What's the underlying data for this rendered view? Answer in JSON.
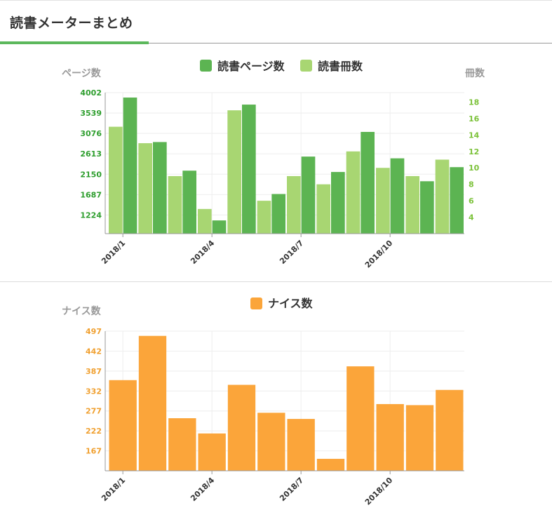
{
  "header": {
    "title": "読書メーターまとめ"
  },
  "colors": {
    "pages": "#5cb452",
    "books": "#a8d672",
    "nice": "#fba53a",
    "left_axis_text": "#2e9e2e",
    "right_axis_text": "#7cc23a",
    "nice_axis_text": "#f0a030"
  },
  "chart_data": [
    {
      "type": "bar",
      "categories": [
        "2018/1",
        "2018/2",
        "2018/3",
        "2018/4",
        "2018/5",
        "2018/6",
        "2018/7",
        "2018/8",
        "2018/9",
        "2018/10",
        "2018/11",
        "2018/12"
      ],
      "xtick_labels": [
        "2018/1",
        "2018/4",
        "2018/7",
        "2018/10"
      ],
      "legend": [
        "読書ページ数",
        "読書冊数"
      ],
      "left_unit": "ページ数",
      "right_unit": "冊数",
      "left_ticks": [
        1224,
        1687,
        2150,
        2613,
        3076,
        3539,
        4002
      ],
      "right_ticks": [
        4,
        6,
        8,
        10,
        12,
        14,
        16,
        18
      ],
      "left_ylim": [
        800,
        4002
      ],
      "right_ylim": [
        2,
        19.15
      ],
      "grid": true,
      "series": [
        {
          "name": "読書ページ数",
          "axis": "left",
          "values": [
            3890,
            2880,
            2230,
            1100,
            3730,
            1700,
            2550,
            2200,
            3110,
            2510,
            1990,
            2310
          ]
        },
        {
          "name": "読書冊数",
          "axis": "right",
          "values": [
            15,
            13,
            9,
            5,
            17,
            6,
            9,
            8,
            12,
            10,
            9,
            11
          ]
        }
      ]
    },
    {
      "type": "bar",
      "categories": [
        "2018/1",
        "2018/2",
        "2018/3",
        "2018/4",
        "2018/5",
        "2018/6",
        "2018/7",
        "2018/8",
        "2018/9",
        "2018/10",
        "2018/11",
        "2018/12"
      ],
      "xtick_labels": [
        "2018/1",
        "2018/4",
        "2018/7",
        "2018/10"
      ],
      "legend": [
        "ナイス数"
      ],
      "left_unit": "ナイス数",
      "left_ticks": [
        167,
        222,
        277,
        332,
        387,
        442,
        497
      ],
      "left_ylim": [
        112,
        497
      ],
      "grid": true,
      "series": [
        {
          "name": "ナイス数",
          "axis": "left",
          "values": [
            362,
            484,
            257,
            215,
            349,
            272,
            255,
            145,
            400,
            296,
            293,
            335
          ]
        }
      ]
    }
  ]
}
